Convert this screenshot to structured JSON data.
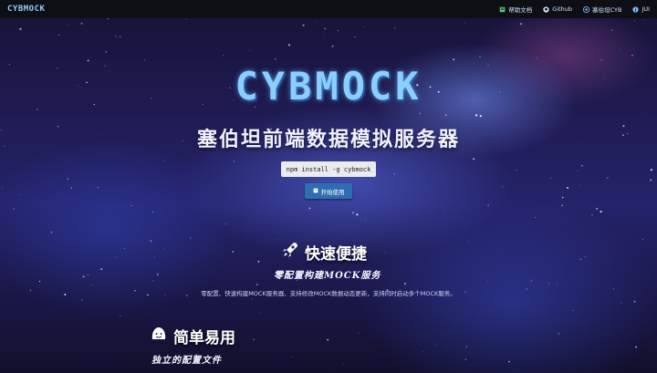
{
  "navbar": {
    "brand": "CYBMOCK",
    "links": [
      {
        "label": "帮助文档",
        "icon": "book-icon"
      },
      {
        "label": "Github",
        "icon": "github-icon"
      },
      {
        "label": "塞伯坦CYB",
        "icon": "cyb-icon"
      },
      {
        "label": "JUI",
        "icon": "info-icon"
      }
    ]
  },
  "hero": {
    "logo": "CYBMOCK",
    "subtitle": "塞伯坦前端数据模拟服务器",
    "install_command": "npm install -g cybmock",
    "start_button": "开始使用"
  },
  "features": [
    {
      "title": "快速便捷",
      "icon": "rocket-icon",
      "subtitle": "零配置构建MOCK服务",
      "description": "零配置、快速构建MOCK服务器、支持修改MOCK数据动态更新，支持同时启动多个MOCK服务。"
    },
    {
      "title": "简单易用",
      "icon": "smile-icon",
      "subtitle": "独立的配置文件",
      "description": ""
    }
  ],
  "colors": {
    "nav_bg": "#0d0f14",
    "logo": "#8ccfff",
    "button": "#2f6db3"
  }
}
